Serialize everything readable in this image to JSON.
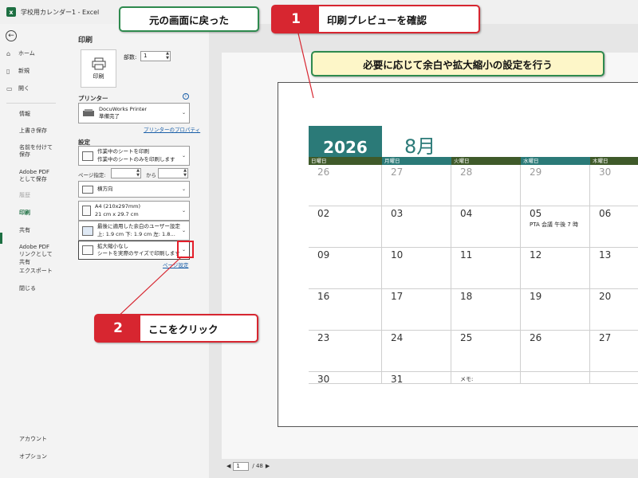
{
  "window": {
    "title": "学校用カレンダー1 - Excel",
    "app_icon": "excel-icon"
  },
  "nav": {
    "back": "←",
    "items": [
      {
        "label": "ホーム",
        "icon": "⌂"
      },
      {
        "label": "新規",
        "icon": "▯"
      },
      {
        "label": "開く",
        "icon": "▭"
      },
      {
        "label": "情報"
      },
      {
        "label": "上書き保存"
      },
      {
        "label": "名前を付けて保存"
      },
      {
        "label": "Adobe PDF として保存"
      },
      {
        "label": "履歴"
      },
      {
        "label": "印刷"
      },
      {
        "label": "共有"
      },
      {
        "label": "Adobe PDF リンクとして共有"
      },
      {
        "label": "エクスポート"
      },
      {
        "label": "閉じる"
      },
      {
        "label": "アカウント"
      },
      {
        "label": "オプション"
      }
    ]
  },
  "print": {
    "title": "印刷",
    "button_label": "印刷",
    "copies_label": "部数:",
    "copies_value": "1",
    "printer_section": "プリンター",
    "printer_name": "DocuWorks Printer",
    "printer_status": "準備完了",
    "printer_props_link": "プリンターのプロパティ",
    "settings_section": "設定",
    "scope_line1": "作業中のシートを印刷",
    "scope_line2": "作業中のシートのみを印刷します",
    "pages_label": "ページ指定:",
    "pages_to": "から",
    "orientation": "横方向",
    "paper_line1": "A4 (210x297mm)",
    "paper_line2": "21 cm x 29.7 cm",
    "margins_line1": "最後に適用した余白のユーザー設定",
    "margins_line2": "上: 1.9 cm 下: 1.9 cm 左: 1.8…",
    "scaling_line1": "拡大縮小なし",
    "scaling_line2": "シートを実際のサイズで印刷します",
    "page_setup_link": "ページ設定"
  },
  "preview": {
    "year": "2026",
    "month": "8月",
    "weekday_headers": [
      "日曜日",
      "月曜日",
      "火曜日",
      "水曜日",
      "木曜日"
    ],
    "header_colors": [
      "#3f5a2a",
      "#2b7a78",
      "#3f5a2a",
      "#2b7a78",
      "#3f5a2a"
    ],
    "weeks": [
      [
        "26",
        "27",
        "28",
        "29",
        "30"
      ],
      [
        "02",
        "03",
        "04",
        "05",
        "06"
      ],
      [
        "09",
        "10",
        "11",
        "12",
        "13"
      ],
      [
        "16",
        "17",
        "18",
        "19",
        "20"
      ],
      [
        "23",
        "24",
        "25",
        "26",
        "27"
      ],
      [
        "30",
        "31",
        "メモ:",
        "",
        ""
      ]
    ],
    "note_text": "PTA 会議 午後 7 時",
    "current_page": "1",
    "total_pages": "/ 48"
  },
  "annotations": {
    "back_to_screen": "元の画面に戻った",
    "step1_num": "1",
    "step1_text": "印刷プレビューを確認",
    "adjust_text": "必要に応じて余白や拡大縮小の設定を行う",
    "step2_num": "2",
    "step2_text": "ここをクリック",
    "accent_red": "#d72630",
    "accent_green": "#2e8a4e"
  }
}
